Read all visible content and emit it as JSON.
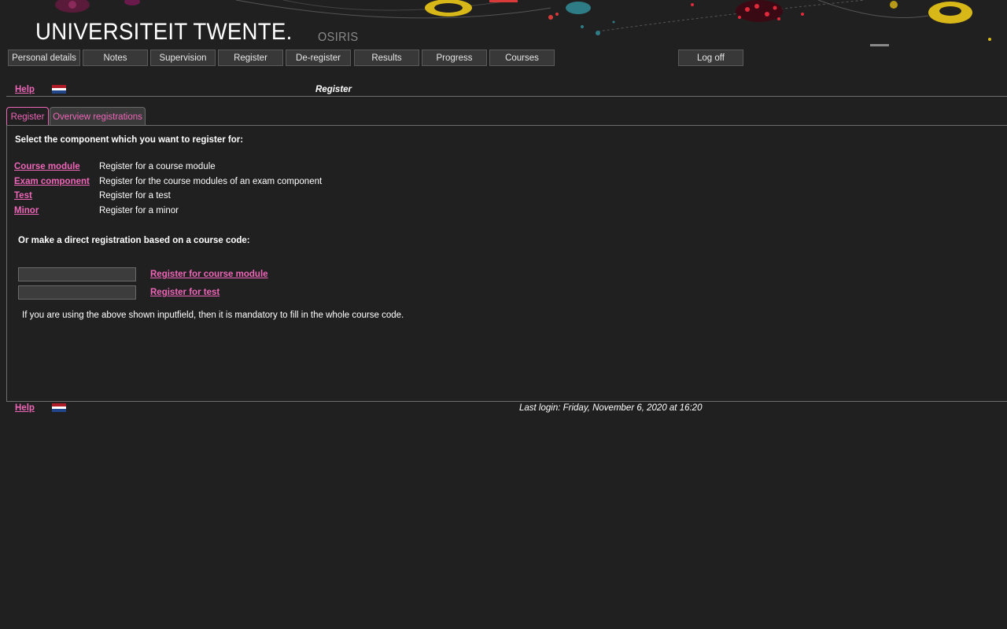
{
  "header": {
    "logo_text": "UNIVERSITEIT TWENTE.",
    "app_name": "OSIRIS"
  },
  "menu": {
    "items": [
      {
        "label": "Personal details"
      },
      {
        "label": "Notes"
      },
      {
        "label": "Supervision"
      },
      {
        "label": "Register"
      },
      {
        "label": "De-register"
      },
      {
        "label": "Results"
      },
      {
        "label": "Progress"
      },
      {
        "label": "Courses"
      }
    ],
    "logoff_label": "Log off"
  },
  "topbar": {
    "help_label": "Help",
    "flag_icon": "dutch-flag-icon",
    "page_title": "Register"
  },
  "tabs": [
    {
      "label": "Register",
      "active": true
    },
    {
      "label": "Overview registrations",
      "active": false
    }
  ],
  "main": {
    "select_prompt": "Select the component which you want to register for:",
    "options": [
      {
        "link": "Course module",
        "description": "Register for a course module"
      },
      {
        "link": "Exam component",
        "description": "Register for the course modules of an exam component"
      },
      {
        "link": "Test",
        "description": "Register for a test"
      },
      {
        "link": "Minor",
        "description": "Register for a minor"
      }
    ],
    "direct_prompt": "Or make a direct registration based on a course code:",
    "direct": [
      {
        "value": "",
        "link": "Register for course module"
      },
      {
        "value": "",
        "link": "Register for test"
      }
    ],
    "note": "If you are using the above shown inputfield, then it is mandatory to fill in the whole course code."
  },
  "footer": {
    "help_label": "Help",
    "flag_icon": "dutch-flag-icon",
    "last_login": "Last login: Friday, November 6, 2020 at 16:20"
  },
  "colors": {
    "background": "#202020",
    "link": "#ee66b8",
    "button_bg": "#383838",
    "flag_red": "#ae1c28",
    "flag_white": "#ffffff",
    "flag_blue": "#21468b"
  }
}
